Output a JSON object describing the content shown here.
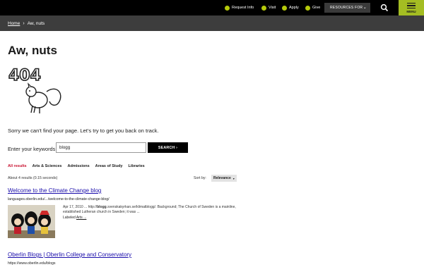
{
  "topbar": {
    "request_info": "Request Info",
    "visit": "Visit",
    "apply": "Apply",
    "give": "Give",
    "resources": "RESOURCES FOR",
    "menu": "MENU"
  },
  "breadcrumb": {
    "home": "Home",
    "current": "Aw, nuts"
  },
  "page": {
    "title": "Aw, nuts",
    "message": "Sorry we can't find your page. Let's try to get you back on track.",
    "art_text": "404"
  },
  "search": {
    "label": "Enter your keywords",
    "value": "blogg",
    "button": "SEARCH ›"
  },
  "filters": {
    "tabs": [
      "All results",
      "Arts & Sciences",
      "Admissions",
      "Areas of Study",
      "Libraries"
    ],
    "active_index": 0
  },
  "results_meta": {
    "count": "About 4 results (0.15 seconds)",
    "sort_label": "Sort by:",
    "sort_value": "Relevance"
  },
  "results": [
    {
      "title": "Welcome to the Climate Change blog",
      "url": "languages.oberlin.edu/.../welcome-to-the-climate-change-blog/",
      "snippet_prefix": "Apr 17, 2010 ... http://",
      "snippet_bold": "blogg",
      "snippet_rest": ".svenskakyrkan.se/klimatblogg/. Background; The Church of Sweden is a mainline, established Lutheran church in Sweden; it was ...",
      "labeled_prefix": "Labeled ",
      "labeled_link": "Arts ..."
    },
    {
      "title": "Oberlin Blogs | Oberlin College and Conservatory",
      "url": "https://www.oberlin.edu/blogs"
    }
  ],
  "colors": {
    "accent_green": "#a4bd22",
    "active_tab_red": "#c8102e",
    "link_blue": "#1a0dab"
  }
}
